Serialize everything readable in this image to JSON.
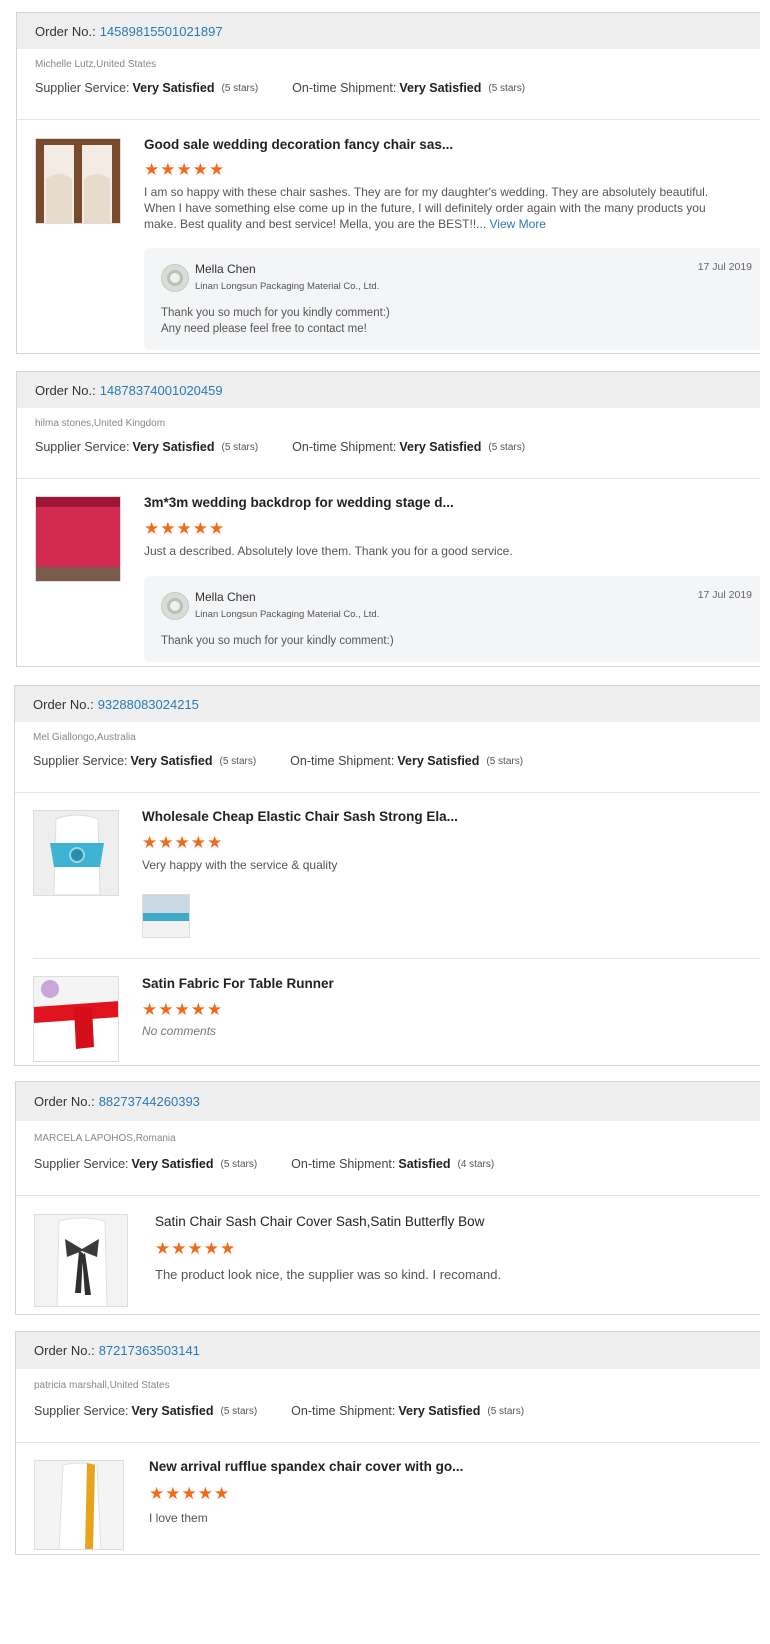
{
  "labels": {
    "order_no": "Order No.:",
    "supplier_service": "Supplier Service:",
    "on_time_shipment": "On-time Shipment:"
  },
  "colors": {
    "star": "#f26b1d",
    "link": "#2a7ab8",
    "header_bg": "#efefef"
  },
  "orders": [
    {
      "order_number": "14589815501021897",
      "buyer": "Michelle Lutz,United States",
      "supplier_rating": "Very Satisfied",
      "supplier_stars": "(5 stars)",
      "shipment_rating": "Very Satisfied",
      "shipment_stars": "(5 stars)",
      "items": [
        {
          "title": "Good sale wedding decoration fancy chair sas...",
          "stars": "★★★★★",
          "review": "I am so happy with these chair sashes.  They are for my daughter's wedding.  They are absolutely beautiful.  When I have something else come up in the future, I will definitely order again with the many products you make. Best quality and best service!  Mella, you are the BEST!!...",
          "view_more": "View More",
          "reply": {
            "name": "Mella Chen",
            "company": "Linan Longsun Packaging Material Co., Ltd.",
            "date": "17 Jul 2019",
            "text_lines": [
              "Thank you so much for you kindly comment:)",
              "Any need please feel free to contact me!"
            ]
          }
        }
      ]
    },
    {
      "order_number": "14878374001020459",
      "buyer": "hilma stones,United Kingdom",
      "supplier_rating": "Very Satisfied",
      "supplier_stars": "(5 stars)",
      "shipment_rating": "Very Satisfied",
      "shipment_stars": "(5 stars)",
      "items": [
        {
          "title": "3m*3m wedding backdrop for wedding stage d...",
          "stars": "★★★★★",
          "review": "Just a described. Absolutely love them. Thank you for a good service.",
          "reply": {
            "name": "Mella Chen",
            "company": "Linan Longsun Packaging Material Co., Ltd.",
            "date": "17 Jul 2019",
            "text_lines": [
              "Thank you so much for your kindly comment:)"
            ]
          }
        }
      ]
    },
    {
      "order_number": "93288083024215",
      "buyer": "Mel Giallongo,Australia",
      "supplier_rating": "Very Satisfied",
      "supplier_stars": "(5 stars)",
      "shipment_rating": "Very Satisfied",
      "shipment_stars": "(5 stars)",
      "items": [
        {
          "title": "Wholesale Cheap Elastic Chair Sash Strong Ela...",
          "stars": "★★★★★",
          "review": "Very happy with the service & quality"
        },
        {
          "title": "Satin Fabric For Table Runner",
          "stars": "★★★★★",
          "no_comment": "No comments"
        }
      ]
    },
    {
      "order_number": "88273744260393",
      "buyer": "MARCELA LAPOHOS,Romania",
      "supplier_rating": "Very Satisfied",
      "supplier_stars": "(5 stars)",
      "shipment_rating": "Satisfied",
      "shipment_stars": "(4 stars)",
      "items": [
        {
          "title": "Satin Chair Sash Chair Cover Sash,Satin Butterfly Bow",
          "stars": "★★★★★",
          "review": "The product look nice, the supplier was so kind. I recomand."
        }
      ]
    },
    {
      "order_number": "87217363503141",
      "buyer": "patricia marshall,United States",
      "supplier_rating": "Very Satisfied",
      "supplier_stars": "(5 stars)",
      "shipment_rating": "Very Satisfied",
      "shipment_stars": "(5 stars)",
      "items": [
        {
          "title": "New arrival rufflue spandex chair cover with go...",
          "stars": "★★★★★",
          "review": "I love them"
        }
      ]
    }
  ]
}
